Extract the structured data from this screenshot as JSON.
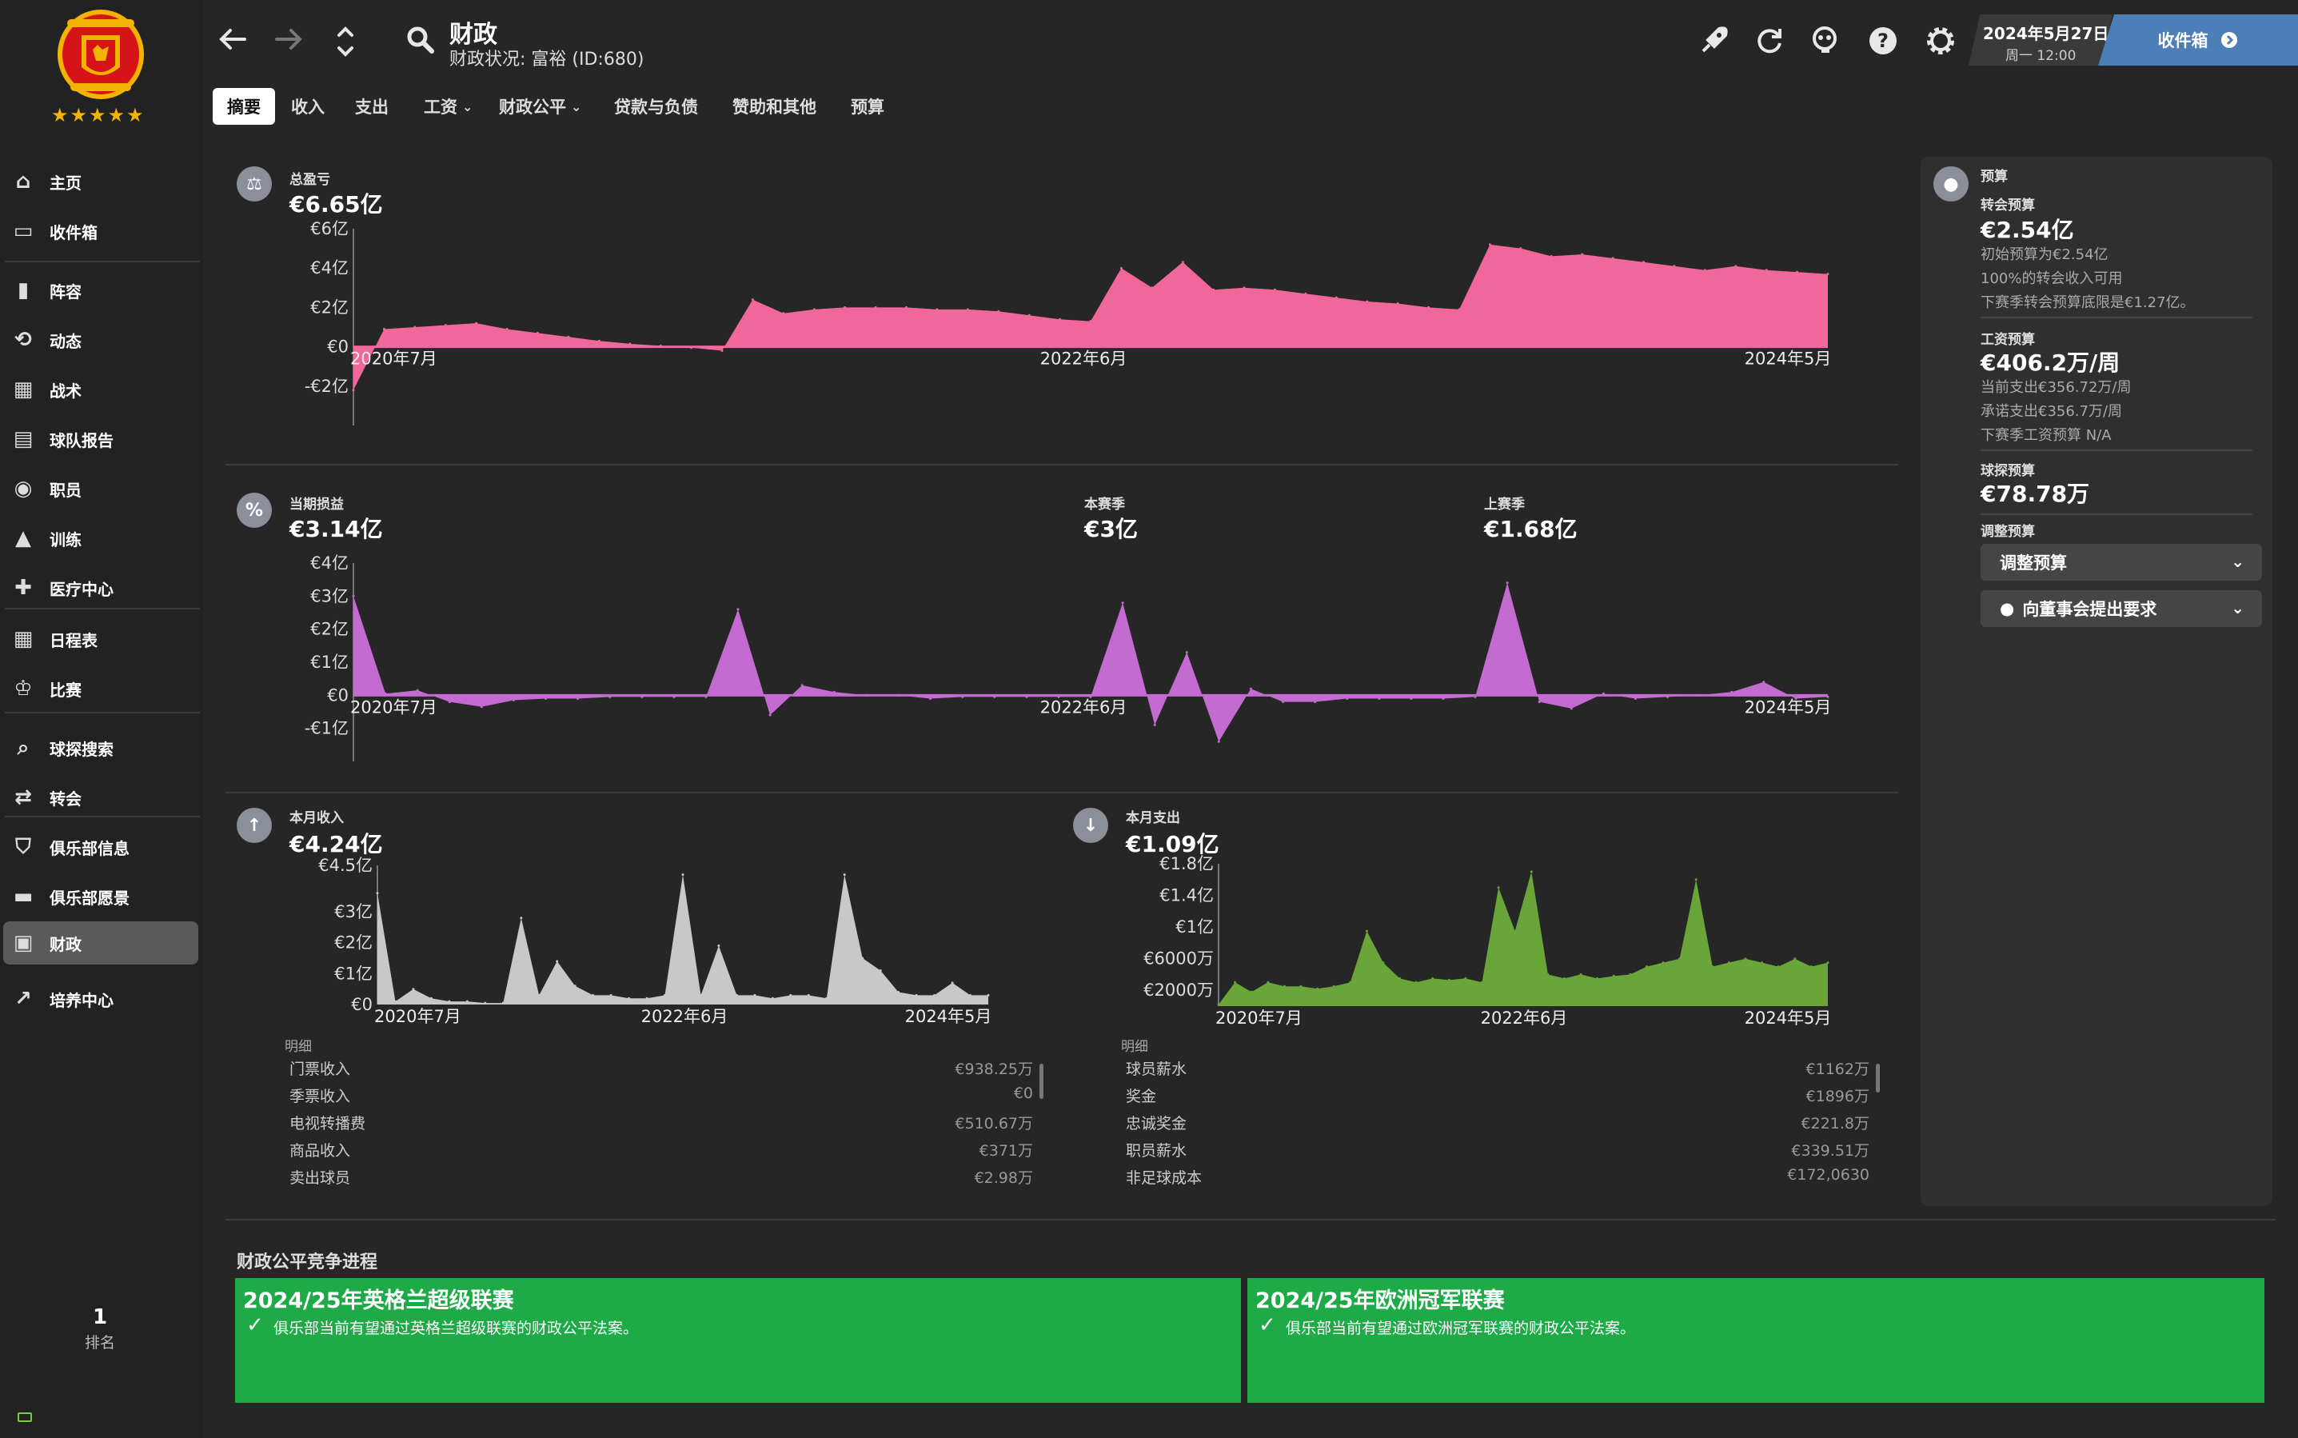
{
  "header": {
    "title": "财政",
    "subtitle": "财政状况: 富裕 (ID:680)",
    "date": "2024年5月27日",
    "weekday_time": "周一 12:00",
    "inbox_label": "收件箱"
  },
  "tabs": [
    {
      "label": "摘要",
      "active": true
    },
    {
      "label": "收入"
    },
    {
      "label": "支出"
    },
    {
      "label": "工资"
    },
    {
      "label": "财政公平"
    },
    {
      "label": "贷款与负债"
    },
    {
      "label": "赞助和其他"
    },
    {
      "label": "预算"
    }
  ],
  "sidebar": {
    "items": [
      {
        "label": "主页",
        "icon": "home-icon"
      },
      {
        "label": "收件箱",
        "icon": "inbox-icon"
      },
      {
        "label": "阵容",
        "icon": "shirt-icon"
      },
      {
        "label": "动态",
        "icon": "dynamics-icon"
      },
      {
        "label": "战术",
        "icon": "tactics-icon"
      },
      {
        "label": "球队报告",
        "icon": "report-icon"
      },
      {
        "label": "职员",
        "icon": "staff-icon"
      },
      {
        "label": "训练",
        "icon": "training-icon"
      },
      {
        "label": "医疗中心",
        "icon": "medical-icon"
      },
      {
        "label": "日程表",
        "icon": "calendar-icon"
      },
      {
        "label": "比赛",
        "icon": "trophy-icon"
      },
      {
        "label": "球探搜索",
        "icon": "search-icon"
      },
      {
        "label": "转会",
        "icon": "transfer-icon"
      },
      {
        "label": "俱乐部信息",
        "icon": "shield-icon"
      },
      {
        "label": "俱乐部愿景",
        "icon": "briefcase-icon"
      },
      {
        "label": "财政",
        "icon": "money-icon",
        "active": true
      },
      {
        "label": "培养中心",
        "icon": "chart-icon"
      }
    ],
    "rank_value": "1",
    "rank_label": "排名"
  },
  "balance": {
    "label": "总盈亏",
    "value": "€6.65亿"
  },
  "profit": {
    "label": "当期损益",
    "value": "€3.14亿",
    "season_label": "本赛季",
    "season_value": "€3亿",
    "last_label": "上赛季",
    "last_value": "€1.68亿"
  },
  "income": {
    "label": "本月收入",
    "value": "€4.24亿",
    "breakdown_label": "明细",
    "rows": [
      {
        "name": "门票收入",
        "value": "€938.25万"
      },
      {
        "name": "季票收入",
        "value": "€0"
      },
      {
        "name": "电视转播费",
        "value": "€510.67万"
      },
      {
        "name": "商品收入",
        "value": "€371万"
      },
      {
        "name": "卖出球员",
        "value": "€2.98万"
      }
    ]
  },
  "expense": {
    "label": "本月支出",
    "value": "€1.09亿",
    "breakdown_label": "明细",
    "rows": [
      {
        "name": "球员薪水",
        "value": "€1162万"
      },
      {
        "name": "奖金",
        "value": "€1896万"
      },
      {
        "name": "忠诚奖金",
        "value": "€221.8万"
      },
      {
        "name": "职员薪水",
        "value": "€339.51万"
      },
      {
        "name": "非足球成本",
        "value": "€172,0630"
      }
    ]
  },
  "budget": {
    "section": "预算",
    "transfer_label": "转会预算",
    "transfer_value": "€2.54亿",
    "transfer_notes": [
      "初始预算为€2.54亿",
      "100%的转会收入可用",
      "下赛季转会预算底限是€1.27亿。"
    ],
    "wage_label": "工资预算",
    "wage_value": "€406.2万/周",
    "wage_notes": [
      "当前支出€356.72万/周",
      "承诺支出€356.7万/周",
      "下赛季工资预算 N/A"
    ],
    "scout_label": "球探预算",
    "scout_value": "€78.78万",
    "adjust_label": "调整预算",
    "adjust_dropdown": "调整预算",
    "request_dropdown": "向董事会提出要求"
  },
  "ffp": {
    "title": "财政公平竞争进程",
    "cards": [
      {
        "title": "2024/25年英格兰超级联赛",
        "message": "俱乐部当前有望通过英格兰超级联赛的财政公平法案。"
      },
      {
        "title": "2024/25年欧洲冠军联赛",
        "message": "俱乐部当前有望通过欧洲冠军联赛的财政公平法案。"
      }
    ]
  },
  "colors": {
    "balance": "#f0679b",
    "profit": "#c36bd0",
    "income": "#c8c8c8",
    "expense": "#6aa53a",
    "ffp_green": "#1faa48",
    "inbox_blue": "#4c7fb8"
  },
  "chart_data": [
    {
      "type": "area",
      "name": "balance",
      "x_tick_labels": [
        "2020年7月",
        "2022年6月",
        "2024年5月"
      ],
      "y_tick_labels": [
        "€6亿",
        "€4亿",
        "€2亿",
        "€0",
        "-€2亿"
      ],
      "ylim": [
        -4,
        6
      ],
      "values": [
        -2.2,
        0.9,
        1.0,
        1.1,
        1.2,
        0.9,
        0.7,
        0.5,
        0.3,
        0.15,
        0.05,
        -0.05,
        -0.2,
        2.4,
        1.7,
        1.9,
        2.0,
        2.0,
        2.0,
        1.9,
        1.9,
        1.8,
        1.6,
        1.4,
        1.3,
        4.0,
        3.0,
        4.3,
        2.9,
        3.0,
        2.9,
        2.7,
        2.5,
        2.3,
        2.2,
        2.0,
        1.9,
        5.2,
        5.0,
        4.6,
        4.7,
        4.5,
        4.3,
        4.1,
        3.9,
        4.1,
        3.9,
        3.8,
        3.7
      ]
    },
    {
      "type": "area",
      "name": "profit",
      "x_tick_labels": [
        "2020年7月",
        "2022年6月",
        "2024年5月"
      ],
      "y_tick_labels": [
        "€4亿",
        "€3亿",
        "€2亿",
        "€1亿",
        "€0",
        "-€1亿"
      ],
      "ylim": [
        -2,
        4
      ],
      "values": [
        3.0,
        0.05,
        0.15,
        -0.2,
        -0.35,
        -0.15,
        -0.1,
        -0.1,
        -0.05,
        -0.05,
        -0.05,
        -0.05,
        2.6,
        -0.6,
        0.3,
        0.1,
        0.0,
        0.0,
        -0.1,
        -0.05,
        -0.05,
        -0.05,
        -0.05,
        -0.05,
        2.8,
        -0.9,
        1.3,
        -1.4,
        0.2,
        -0.2,
        -0.2,
        -0.1,
        -0.1,
        -0.1,
        -0.1,
        -0.05,
        3.4,
        -0.2,
        -0.4,
        0.05,
        -0.1,
        -0.05,
        0.0,
        0.1,
        0.4,
        -0.1,
        -0.05
      ]
    },
    {
      "type": "area",
      "name": "income",
      "x_tick_labels": [
        "2020年7月",
        "2022年6月",
        "2024年5月"
      ],
      "y_tick_labels": [
        "€4.5亿",
        "€3亿",
        "€2亿",
        "€1亿",
        "€0"
      ],
      "ylim": [
        0,
        4.5
      ],
      "values": [
        3.6,
        0.1,
        0.5,
        0.2,
        0.1,
        0.1,
        0.05,
        0.05,
        2.8,
        0.3,
        1.4,
        0.6,
        0.3,
        0.3,
        0.2,
        0.2,
        0.3,
        4.2,
        0.3,
        1.9,
        0.3,
        0.3,
        0.2,
        0.3,
        0.3,
        0.2,
        4.2,
        1.5,
        1.1,
        0.4,
        0.3,
        0.3,
        0.7,
        0.3,
        0.3
      ]
    },
    {
      "type": "area",
      "name": "expense",
      "x_tick_labels": [
        "2020年7月",
        "2022年6月",
        "2024年5月"
      ],
      "y_tick_labels": [
        "€1.8亿",
        "€1.4亿",
        "€1亿",
        "€6000万",
        "€2000万"
      ],
      "ylim": [
        0,
        1.8
      ],
      "values": [
        0.02,
        0.3,
        0.18,
        0.3,
        0.25,
        0.25,
        0.22,
        0.25,
        0.3,
        0.95,
        0.55,
        0.35,
        0.3,
        0.35,
        0.33,
        0.35,
        0.3,
        1.5,
        0.95,
        1.7,
        0.4,
        0.35,
        0.4,
        0.35,
        0.38,
        0.4,
        0.5,
        0.55,
        0.6,
        1.6,
        0.5,
        0.55,
        0.6,
        0.55,
        0.5,
        0.6,
        0.5,
        0.55
      ]
    }
  ]
}
